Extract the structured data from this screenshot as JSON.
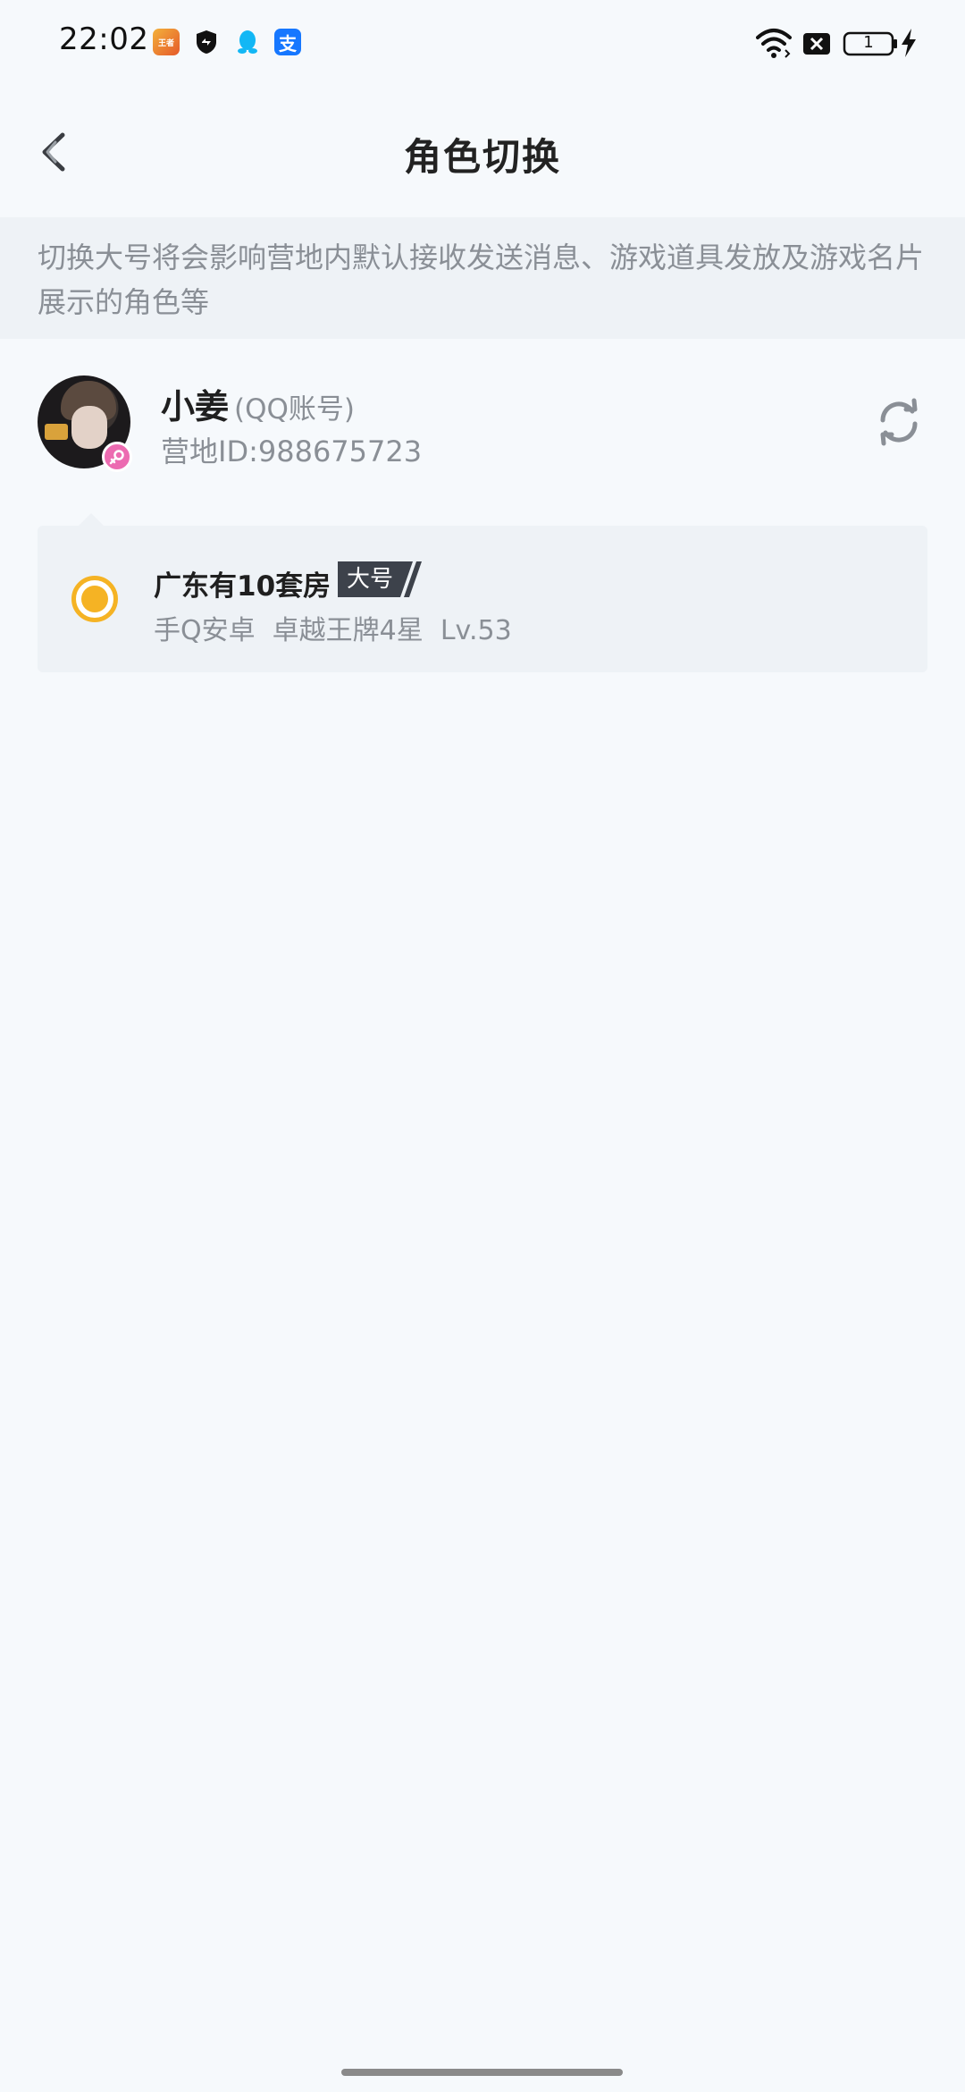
{
  "status_bar": {
    "time": "22:02",
    "app_icons": [
      "game-app-icon",
      "shield-app-icon",
      "qq-icon",
      "alipay-icon"
    ],
    "alipay_glyph": "支",
    "game_glyph": "王者",
    "battery_level": "1"
  },
  "header": {
    "title": "角色切换",
    "back_icon": "chevron-left-icon"
  },
  "notice": {
    "text": "切换大号将会影响营地内默认接收发送消息、游戏道具发放及游戏名片展示的角色等"
  },
  "account": {
    "name": "小姜",
    "type": "(QQ账号)",
    "id": "营地ID:988675723",
    "gender_icon": "female-icon",
    "refresh_icon": "refresh-icon"
  },
  "role": {
    "name": "广东有10套房",
    "badge": "大号",
    "detail": "手Q安卓  卓越王牌4星  Lv.53",
    "selected": true
  },
  "colors": {
    "accent": "#f5b324",
    "background": "#f6f9fc",
    "card": "#eef2f6",
    "muted_text": "#8a8f96",
    "badge_bg": "#3d424b",
    "gender_pink": "#ec6bb1"
  }
}
